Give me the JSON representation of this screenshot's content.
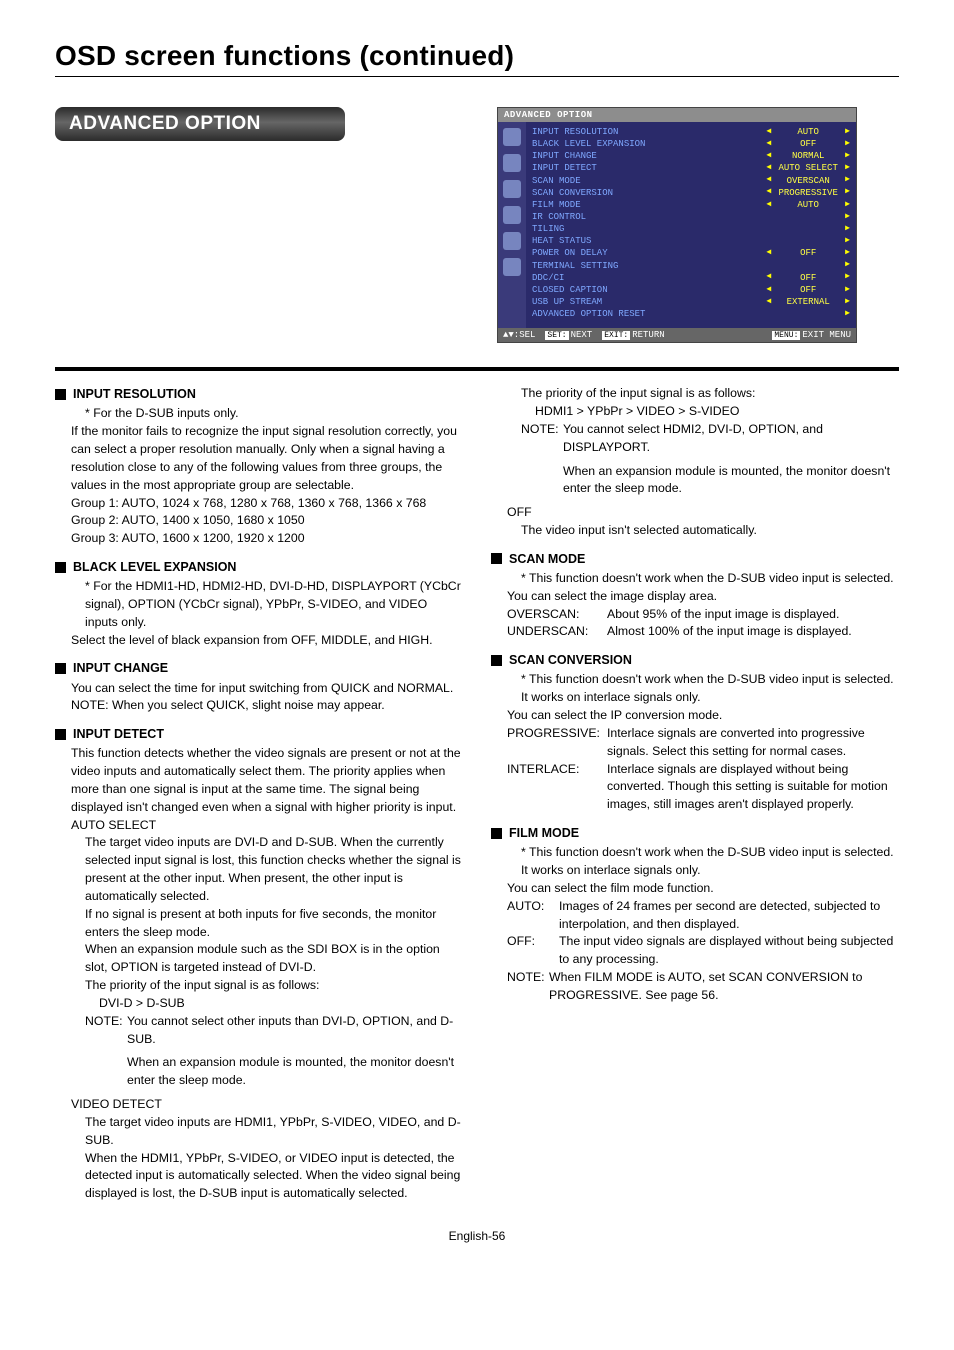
{
  "page": {
    "title": "OSD screen functions (continued)",
    "footer": "English-56"
  },
  "pill": {
    "label": "ADVANCED OPTION"
  },
  "osd": {
    "header": "ADVANCED OPTION",
    "rows": [
      {
        "label": "INPUT RESOLUTION",
        "val": "AUTO",
        "left": true,
        "right": true
      },
      {
        "label": "BLACK LEVEL EXPANSION",
        "val": "OFF",
        "left": true,
        "right": true
      },
      {
        "label": "INPUT CHANGE",
        "val": "NORMAL",
        "left": true,
        "right": true
      },
      {
        "label": "INPUT DETECT",
        "val": "AUTO SELECT",
        "left": true,
        "right": true
      },
      {
        "label": "SCAN MODE",
        "val": "OVERSCAN",
        "left": true,
        "right": true
      },
      {
        "label": "SCAN CONVERSION",
        "val": "PROGRESSIVE",
        "left": true,
        "right": true
      },
      {
        "label": "FILM MODE",
        "val": "AUTO",
        "left": true,
        "right": true
      },
      {
        "label": "IR CONTROL",
        "val": "",
        "left": false,
        "right": true
      },
      {
        "label": "TILING",
        "val": "",
        "left": false,
        "right": true
      },
      {
        "label": "HEAT STATUS",
        "val": "",
        "left": false,
        "right": true
      },
      {
        "label": "POWER ON DELAY",
        "val": "OFF",
        "left": true,
        "right": true
      },
      {
        "label": "TERMINAL SETTING",
        "val": "",
        "left": false,
        "right": true
      },
      {
        "label": "DDC/CI",
        "val": "OFF",
        "left": true,
        "right": true
      },
      {
        "label": "CLOSED CAPTION",
        "val": "OFF",
        "left": true,
        "right": true
      },
      {
        "label": "USB UP STREAM",
        "val": "EXTERNAL",
        "left": true,
        "right": true
      },
      {
        "label": "ADVANCED OPTION RESET",
        "val": "",
        "left": false,
        "right": true
      }
    ],
    "bottom": {
      "sel": "SEL",
      "next": "NEXT",
      "return": "RETURN",
      "exit": "EXIT MENU",
      "btn_sel": "▲▼:",
      "btn_next": "SET:",
      "btn_return": "EXIT:",
      "btn_exit": "MENU:"
    }
  },
  "left": {
    "input_resolution": {
      "title": "INPUT RESOLUTION",
      "note": "* For the D-SUB inputs only.",
      "p1": "If the monitor fails to recognize the input signal resolution correctly, you can select a proper resolution manually. Only when a signal having a resolution close to any of the following values from three groups, the values in the most appropriate group are selectable.",
      "g1": "Group 1: AUTO, 1024 x 768, 1280 x 768, 1360 x 768, 1366 x 768",
      "g2": "Group 2: AUTO, 1400 x 1050, 1680 x 1050",
      "g3": "Group 3: AUTO, 1600 x 1200, 1920 x 1200"
    },
    "black_level": {
      "title": "BLACK LEVEL EXPANSION",
      "note": "* For the HDMI1-HD, HDMI2-HD, DVI-D-HD, DISPLAYPORT (YCbCr signal), OPTION (YCbCr signal), YPbPr, S-VIDEO, and VIDEO inputs only.",
      "p": "Select the level of black expansion from OFF, MIDDLE, and HIGH."
    },
    "input_change": {
      "title": "INPUT CHANGE",
      "p": "You can select the time for input switching from QUICK and NORMAL.",
      "note": "NOTE: When you select QUICK, slight noise may appear."
    },
    "input_detect": {
      "title": "INPUT DETECT",
      "p": "This function detects whether the video signals are present or not at the video inputs and automatically select them. The priority applies when more than one signal is input at the same time. The signal being displayed isn't changed even when a signal with higher priority is input.",
      "auto_label": "AUTO SELECT",
      "auto_p1": "The target video inputs are DVI-D and D-SUB. When the currently selected input signal is lost, this function checks whether the signal is present at the other input. When present, the other input is automatically selected.",
      "auto_p2": "If no signal is present at both inputs for five seconds, the monitor enters the sleep mode.",
      "auto_p3": "When an expansion module such as the SDI BOX is in the option slot, OPTION is targeted instead of DVI-D.",
      "auto_p4": "The priority of the input signal is as follows:",
      "auto_p5": "DVI-D > D-SUB",
      "auto_note1": "NOTE: You cannot select other inputs than DVI-D, OPTION, and D-SUB.",
      "auto_note2": "When an expansion module is mounted, the monitor doesn't enter the sleep mode.",
      "video_label": "VIDEO DETECT",
      "video_p1": "The target video inputs are HDMI1, YPbPr, S-VIDEO, VIDEO, and D-SUB.",
      "video_p2": "When the HDMI1, YPbPr, S-VIDEO, or VIDEO input is detected, the detected input is automatically selected. When the video signal being displayed is lost, the D-SUB input is automatically selected."
    }
  },
  "right": {
    "video_cont": {
      "p1": "The priority of the input signal is as follows:",
      "p2": "HDMI1 > YPbPr > VIDEO > S-VIDEO",
      "note1": "NOTE: You cannot select HDMI2, DVI-D, OPTION, and DISPLAYPORT.",
      "note2": "When an expansion module is mounted, the monitor doesn't enter the sleep mode.",
      "off_label": "OFF",
      "off_p": "The video input isn't selected automatically."
    },
    "scan_mode": {
      "title": "SCAN MODE",
      "note": "* This function doesn't work when the D-SUB video input is selected.",
      "p": "You can select the image display area.",
      "over_k": "OVERSCAN:",
      "over_v": "About 95% of the input image is displayed.",
      "under_k": "UNDERSCAN:",
      "under_v": "Almost 100% of the input image is displayed."
    },
    "scan_conv": {
      "title": "SCAN CONVERSION",
      "note1": "* This function doesn't work when the D-SUB video input is selected.",
      "note2": "It works on interlace signals only.",
      "p": "You can select the IP conversion mode.",
      "prog_k": "PROGRESSIVE:",
      "prog_v": "Interlace signals are converted into progressive signals. Select this setting for normal cases.",
      "int_k": "INTERLACE:",
      "int_v": "Interlace signals are displayed without being converted. Though this setting is suitable for motion images, still images aren't displayed properly."
    },
    "film_mode": {
      "title": "FILM MODE",
      "note1": "* This function doesn't work when the D-SUB video input is selected.",
      "note2": "It works on interlace signals only.",
      "p": "You can select the film mode function.",
      "auto_k": "AUTO:",
      "auto_v": "Images of 24 frames per second are detected, subjected to interpolation, and then displayed.",
      "off_k": "OFF:",
      "off_v": "The input video signals are displayed without being subjected to any processing.",
      "note3": "NOTE: When FILM MODE is AUTO, set SCAN CONVERSION to PROGRESSIVE. See page 56."
    }
  }
}
